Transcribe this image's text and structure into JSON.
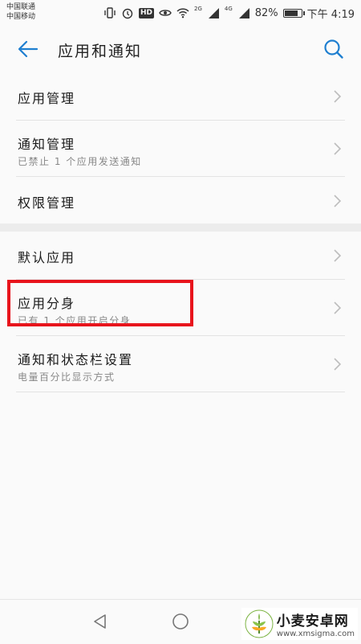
{
  "status_bar": {
    "carrier1": "中国联通",
    "carrier2": "中国移动",
    "hd": "HD",
    "network1": "2G",
    "network2": "4G",
    "battery": "82%",
    "battery_level": 0.82,
    "time": "下午 4:19"
  },
  "header": {
    "title": "应用和通知",
    "back_icon": "back-arrow-icon",
    "search_icon": "search-icon"
  },
  "section1": [
    {
      "label": "应用管理",
      "sub": ""
    },
    {
      "label": "通知管理",
      "sub": "已禁止 1 个应用发送通知"
    },
    {
      "label": "权限管理",
      "sub": ""
    }
  ],
  "section2": [
    {
      "label": "默认应用",
      "sub": ""
    },
    {
      "label": "应用分身",
      "sub": "已有 1 个应用开启分身"
    },
    {
      "label": "通知和状态栏设置",
      "sub": "电量百分比显示方式"
    }
  ],
  "colors": {
    "accent": "#1f7fd0",
    "highlight": "#e8141c"
  },
  "watermark": {
    "name": "小麦安卓网",
    "url": "www.xmsigma.com"
  }
}
